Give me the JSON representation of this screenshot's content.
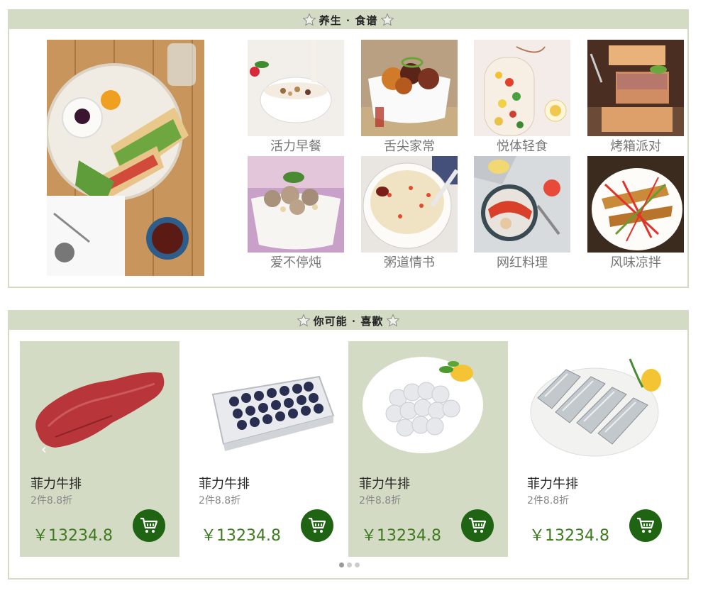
{
  "recipe_section": {
    "title": "养生 · 食谱",
    "categories": [
      {
        "label": "活力早餐"
      },
      {
        "label": "舌尖家常"
      },
      {
        "label": "悦体轻食"
      },
      {
        "label": "烤箱派对"
      },
      {
        "label": "爱不停炖"
      },
      {
        "label": "粥道情书"
      },
      {
        "label": "网红料理"
      },
      {
        "label": "风味凉拌"
      }
    ]
  },
  "products_section": {
    "title": "你可能 · 喜歡",
    "products": [
      {
        "name": "菲力牛排",
        "promo": "2件8.8折",
        "price": "￥13234.8",
        "image": "beef-steak"
      },
      {
        "name": "菲力牛排",
        "promo": "2件8.8折",
        "price": "￥13234.8",
        "image": "blueberries"
      },
      {
        "name": "菲力牛排",
        "promo": "2件8.8折",
        "price": "￥13234.8",
        "image": "shrimp"
      },
      {
        "name": "菲力牛排",
        "promo": "2件8.8折",
        "price": "￥13234.8",
        "image": "hairtail-fish"
      }
    ],
    "carousel": {
      "active_page": 1,
      "total_pages": 3
    }
  },
  "colors": {
    "header_bg": "#d3dbc5",
    "price": "#3e7a1f",
    "cart_button": "#1e6412"
  }
}
